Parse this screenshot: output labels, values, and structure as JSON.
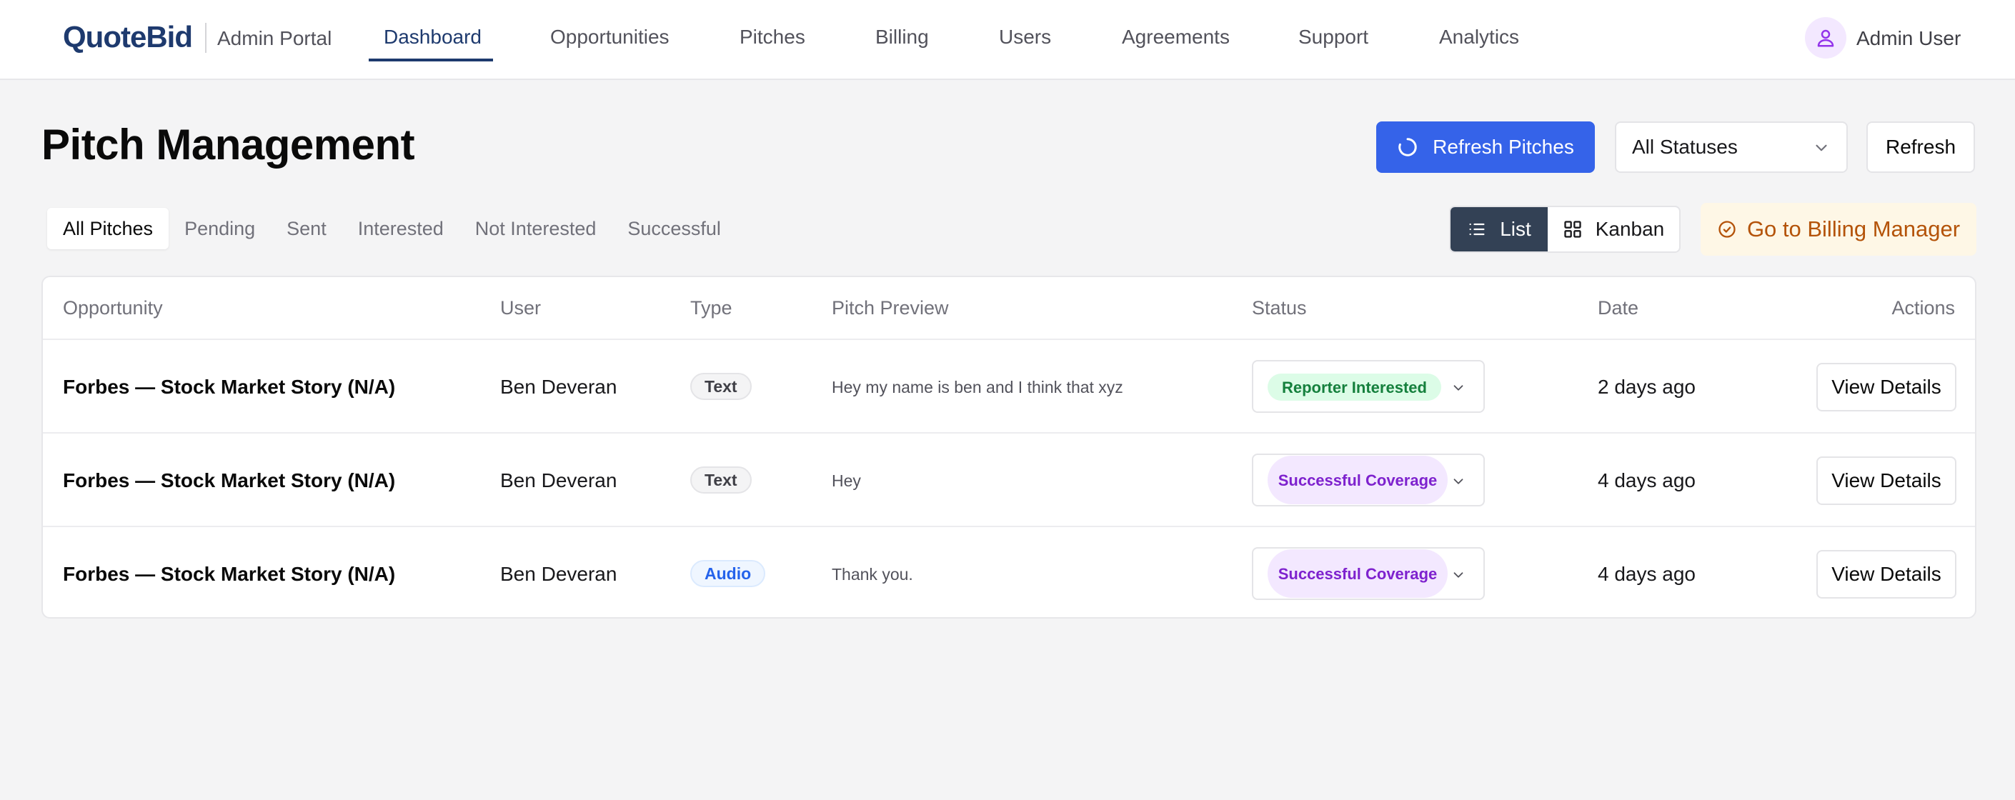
{
  "nav": {
    "brand": "QuoteBid",
    "portal": "Admin Portal",
    "links": [
      "Dashboard",
      "Opportunities",
      "Pitches",
      "Billing",
      "Users",
      "Agreements",
      "Support",
      "Analytics"
    ],
    "active": "Dashboard",
    "user_name": "Admin User",
    "user_icon": "user-icon"
  },
  "header": {
    "title": "Pitch Management",
    "refresh_pitches_label": "Refresh Pitches",
    "status_filter_value": "All Statuses",
    "refresh_label": "Refresh"
  },
  "tabs": [
    "All Pitches",
    "Pending",
    "Sent",
    "Interested",
    "Not Interested",
    "Successful"
  ],
  "active_tab": "All Pitches",
  "view_toggle": {
    "list": "List",
    "kanban": "Kanban",
    "active": "List"
  },
  "billing_button": "Go to Billing Manager",
  "table": {
    "columns": [
      "Opportunity",
      "User",
      "Type",
      "Pitch Preview",
      "Status",
      "Date",
      "Actions"
    ],
    "rows": [
      {
        "opportunity": "Forbes — Stock Market Story (N/A)",
        "user": "Ben Deveran",
        "type": "Text",
        "preview": "Hey my name is ben and I think that xyz",
        "status": "Reporter Interested",
        "date": "2 days ago",
        "action": "View Details"
      },
      {
        "opportunity": "Forbes — Stock Market Story (N/A)",
        "user": "Ben Deveran",
        "type": "Text",
        "preview": "Hey",
        "status": "Successful Coverage",
        "date": "4 days ago",
        "action": "View Details"
      },
      {
        "opportunity": "Forbes — Stock Market Story (N/A)",
        "user": "Ben Deveran",
        "type": "Audio",
        "preview": "Thank you.",
        "status": "Successful Coverage",
        "date": "4 days ago",
        "action": "View Details"
      }
    ]
  },
  "colors": {
    "brand": "#1e3a6e",
    "primary": "#3563e9",
    "interested_bg": "#dcfce7",
    "interested_fg": "#15803d",
    "success_bg": "#f3e8ff",
    "success_fg": "#7e22ce",
    "billing_fg": "#b45309"
  }
}
